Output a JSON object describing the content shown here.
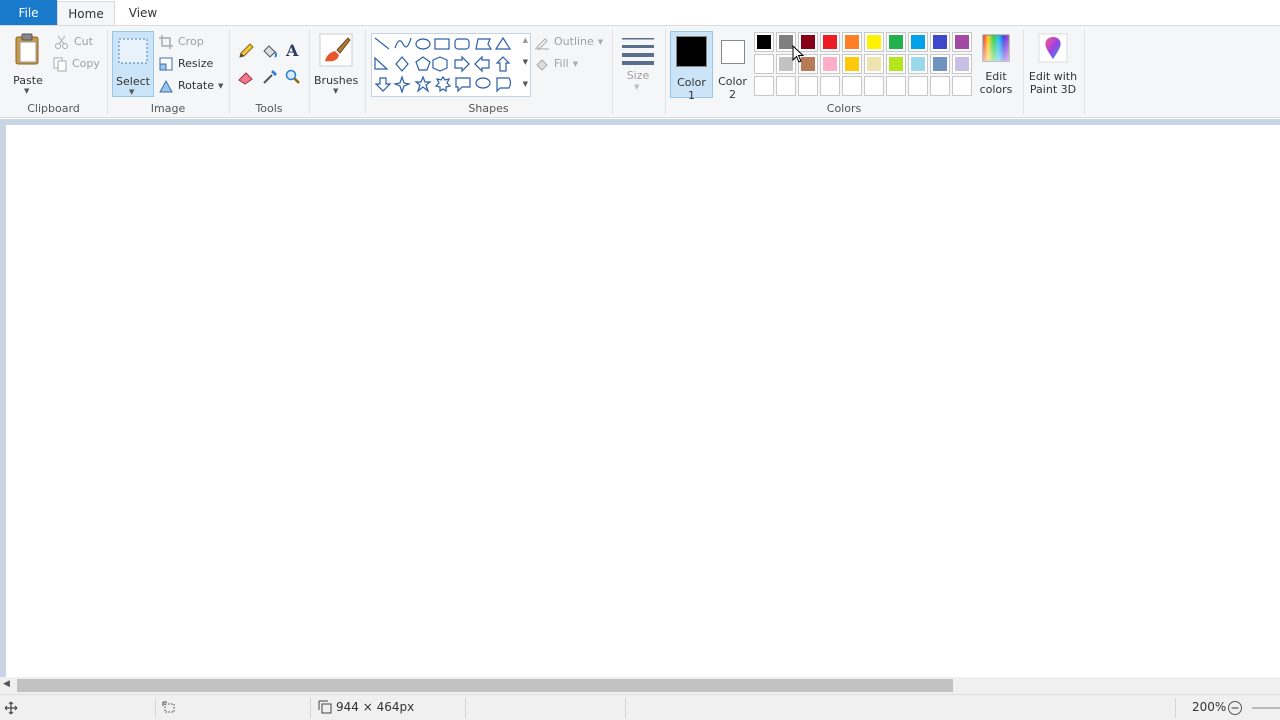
{
  "tabs": {
    "file": "File",
    "home": "Home",
    "view": "View"
  },
  "clipboard": {
    "paste": "Paste",
    "cut": "Cut",
    "copy": "Copy",
    "group": "Clipboard"
  },
  "image": {
    "select": "Select",
    "crop": "Crop",
    "resize": "Resize",
    "rotate": "Rotate",
    "group": "Image"
  },
  "tools": {
    "group": "Tools"
  },
  "brushes": {
    "label": "Brushes"
  },
  "shapes": {
    "outline": "Outline",
    "fill": "Fill",
    "group": "Shapes"
  },
  "size": {
    "label": "Size"
  },
  "colors": {
    "color1_line1": "Color",
    "color1_line2": "1",
    "color2_line1": "Color",
    "color2_line2": "2",
    "edit_line1": "Edit",
    "edit_line2": "colors",
    "group": "Colors",
    "color1_value": "#000000",
    "color2_value": "#ffffff",
    "palette_row1": [
      "#000000",
      "#7f7f7f",
      "#880015",
      "#ed1c24",
      "#ff7f27",
      "#fff200",
      "#22b14c",
      "#00a2e8",
      "#3f48cc",
      "#a349a4"
    ],
    "palette_row2": [
      "#ffffff",
      "#c3c3c3",
      "#b97a57",
      "#ffaec9",
      "#ffc90e",
      "#efe4b0",
      "#b5e61d",
      "#99d9ea",
      "#7092be",
      "#c8bfe7"
    ]
  },
  "paint3d": {
    "line1": "Edit with",
    "line2": "Paint 3D"
  },
  "status": {
    "dimensions": "944 × 464px",
    "zoom": "200%"
  }
}
